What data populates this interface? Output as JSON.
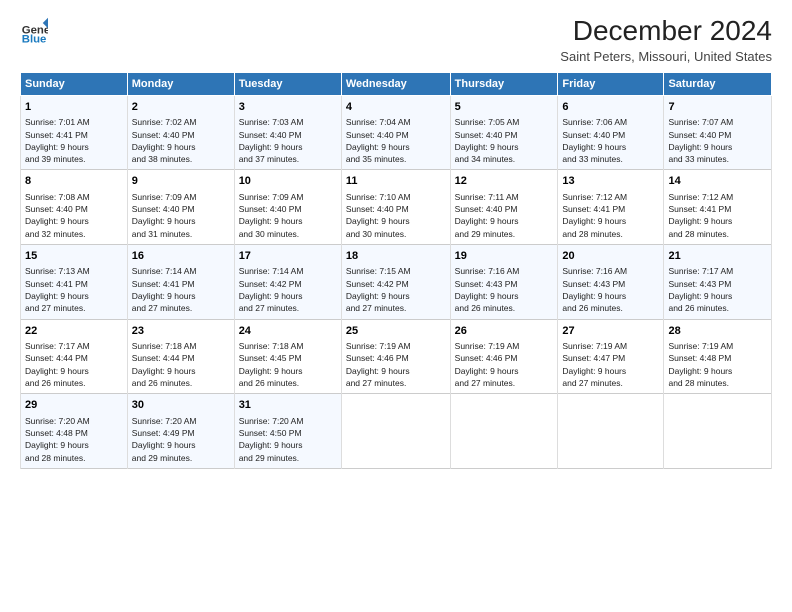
{
  "logo": {
    "line1": "General",
    "line2": "Blue"
  },
  "title": "December 2024",
  "subtitle": "Saint Peters, Missouri, United States",
  "days_header": [
    "Sunday",
    "Monday",
    "Tuesday",
    "Wednesday",
    "Thursday",
    "Friday",
    "Saturday"
  ],
  "weeks": [
    [
      {
        "day": "1",
        "info": "Sunrise: 7:01 AM\nSunset: 4:41 PM\nDaylight: 9 hours\nand 39 minutes."
      },
      {
        "day": "2",
        "info": "Sunrise: 7:02 AM\nSunset: 4:40 PM\nDaylight: 9 hours\nand 38 minutes."
      },
      {
        "day": "3",
        "info": "Sunrise: 7:03 AM\nSunset: 4:40 PM\nDaylight: 9 hours\nand 37 minutes."
      },
      {
        "day": "4",
        "info": "Sunrise: 7:04 AM\nSunset: 4:40 PM\nDaylight: 9 hours\nand 35 minutes."
      },
      {
        "day": "5",
        "info": "Sunrise: 7:05 AM\nSunset: 4:40 PM\nDaylight: 9 hours\nand 34 minutes."
      },
      {
        "day": "6",
        "info": "Sunrise: 7:06 AM\nSunset: 4:40 PM\nDaylight: 9 hours\nand 33 minutes."
      },
      {
        "day": "7",
        "info": "Sunrise: 7:07 AM\nSunset: 4:40 PM\nDaylight: 9 hours\nand 33 minutes."
      }
    ],
    [
      {
        "day": "8",
        "info": "Sunrise: 7:08 AM\nSunset: 4:40 PM\nDaylight: 9 hours\nand 32 minutes."
      },
      {
        "day": "9",
        "info": "Sunrise: 7:09 AM\nSunset: 4:40 PM\nDaylight: 9 hours\nand 31 minutes."
      },
      {
        "day": "10",
        "info": "Sunrise: 7:09 AM\nSunset: 4:40 PM\nDaylight: 9 hours\nand 30 minutes."
      },
      {
        "day": "11",
        "info": "Sunrise: 7:10 AM\nSunset: 4:40 PM\nDaylight: 9 hours\nand 30 minutes."
      },
      {
        "day": "12",
        "info": "Sunrise: 7:11 AM\nSunset: 4:40 PM\nDaylight: 9 hours\nand 29 minutes."
      },
      {
        "day": "13",
        "info": "Sunrise: 7:12 AM\nSunset: 4:41 PM\nDaylight: 9 hours\nand 28 minutes."
      },
      {
        "day": "14",
        "info": "Sunrise: 7:12 AM\nSunset: 4:41 PM\nDaylight: 9 hours\nand 28 minutes."
      }
    ],
    [
      {
        "day": "15",
        "info": "Sunrise: 7:13 AM\nSunset: 4:41 PM\nDaylight: 9 hours\nand 27 minutes."
      },
      {
        "day": "16",
        "info": "Sunrise: 7:14 AM\nSunset: 4:41 PM\nDaylight: 9 hours\nand 27 minutes."
      },
      {
        "day": "17",
        "info": "Sunrise: 7:14 AM\nSunset: 4:42 PM\nDaylight: 9 hours\nand 27 minutes."
      },
      {
        "day": "18",
        "info": "Sunrise: 7:15 AM\nSunset: 4:42 PM\nDaylight: 9 hours\nand 27 minutes."
      },
      {
        "day": "19",
        "info": "Sunrise: 7:16 AM\nSunset: 4:43 PM\nDaylight: 9 hours\nand 26 minutes."
      },
      {
        "day": "20",
        "info": "Sunrise: 7:16 AM\nSunset: 4:43 PM\nDaylight: 9 hours\nand 26 minutes."
      },
      {
        "day": "21",
        "info": "Sunrise: 7:17 AM\nSunset: 4:43 PM\nDaylight: 9 hours\nand 26 minutes."
      }
    ],
    [
      {
        "day": "22",
        "info": "Sunrise: 7:17 AM\nSunset: 4:44 PM\nDaylight: 9 hours\nand 26 minutes."
      },
      {
        "day": "23",
        "info": "Sunrise: 7:18 AM\nSunset: 4:44 PM\nDaylight: 9 hours\nand 26 minutes."
      },
      {
        "day": "24",
        "info": "Sunrise: 7:18 AM\nSunset: 4:45 PM\nDaylight: 9 hours\nand 26 minutes."
      },
      {
        "day": "25",
        "info": "Sunrise: 7:19 AM\nSunset: 4:46 PM\nDaylight: 9 hours\nand 27 minutes."
      },
      {
        "day": "26",
        "info": "Sunrise: 7:19 AM\nSunset: 4:46 PM\nDaylight: 9 hours\nand 27 minutes."
      },
      {
        "day": "27",
        "info": "Sunrise: 7:19 AM\nSunset: 4:47 PM\nDaylight: 9 hours\nand 27 minutes."
      },
      {
        "day": "28",
        "info": "Sunrise: 7:19 AM\nSunset: 4:48 PM\nDaylight: 9 hours\nand 28 minutes."
      }
    ],
    [
      {
        "day": "29",
        "info": "Sunrise: 7:20 AM\nSunset: 4:48 PM\nDaylight: 9 hours\nand 28 minutes."
      },
      {
        "day": "30",
        "info": "Sunrise: 7:20 AM\nSunset: 4:49 PM\nDaylight: 9 hours\nand 29 minutes."
      },
      {
        "day": "31",
        "info": "Sunrise: 7:20 AM\nSunset: 4:50 PM\nDaylight: 9 hours\nand 29 minutes."
      },
      null,
      null,
      null,
      null
    ]
  ]
}
